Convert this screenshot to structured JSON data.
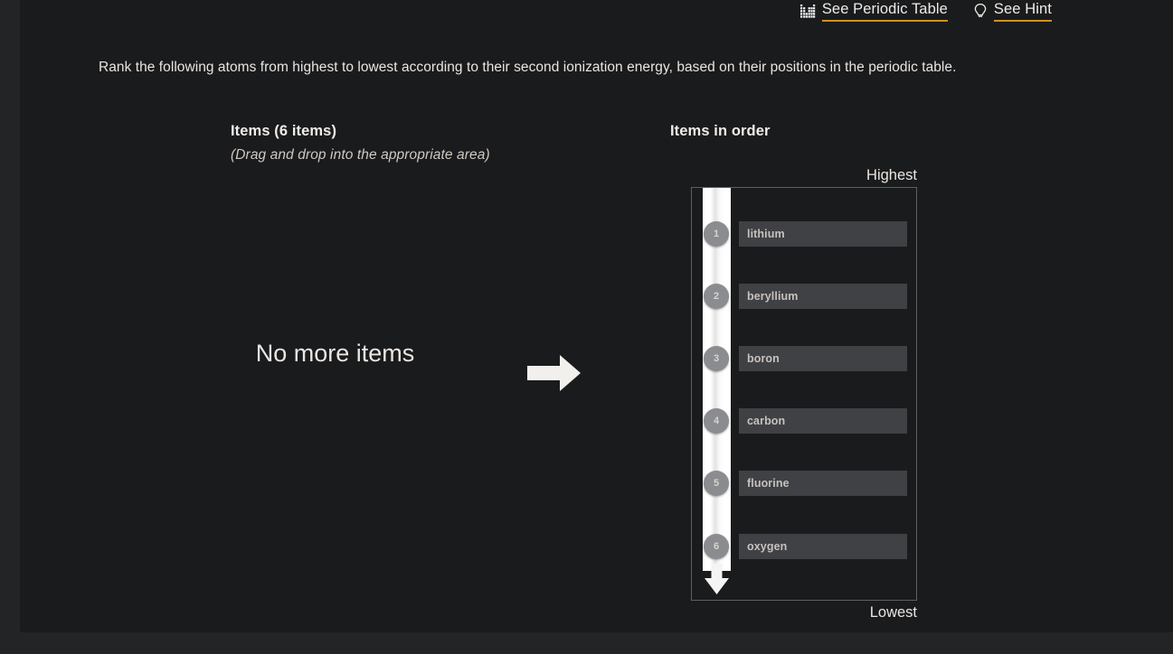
{
  "toolbar": {
    "periodic_table_link": "See Periodic Table",
    "periodic_table_icon": "periodic-table-icon",
    "hint_link": "See Hint",
    "hint_icon": "lightbulb-icon",
    "underline_color": "#d0911f"
  },
  "prompt": {
    "text": "Rank the following atoms from highest to lowest according to their second ionization energy, based on their positions in the periodic table."
  },
  "items_panel": {
    "title": "Items (6 items)",
    "subtitle": "(Drag and drop into the appropriate area)",
    "empty_message": "No more items",
    "arrow_icon": "right-arrow-icon"
  },
  "order_panel": {
    "title": "Items in order",
    "top_label": "Highest",
    "bottom_label": "Lowest",
    "track_icon": "down-arrow-track-icon",
    "slots": [
      {
        "rank": "1",
        "label": "lithium"
      },
      {
        "rank": "2",
        "label": "beryllium"
      },
      {
        "rank": "3",
        "label": "boron"
      },
      {
        "rank": "4",
        "label": "carbon"
      },
      {
        "rank": "5",
        "label": "fluorine"
      },
      {
        "rank": "6",
        "label": "oxygen"
      }
    ]
  },
  "theme": {
    "page_background": "#232426",
    "card_background": "#1a1b1d",
    "item_background": "#3f4145",
    "badge_background": "#8a8c8f",
    "accent": "#d0911f",
    "text": "#e8e4df"
  }
}
